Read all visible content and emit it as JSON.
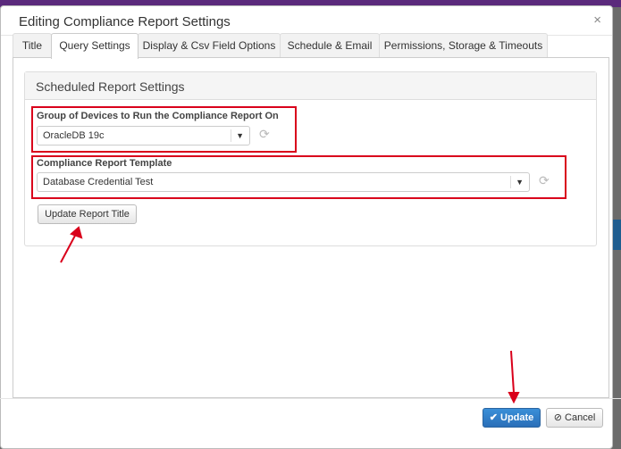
{
  "modal": {
    "title": "Editing Compliance Report Settings",
    "close_glyph": "×"
  },
  "tabs": [
    {
      "label": "Title",
      "active": false
    },
    {
      "label": "Query Settings",
      "active": true
    },
    {
      "label": "Display & Csv Field Options",
      "active": false
    },
    {
      "label": "Schedule & Email",
      "active": false
    },
    {
      "label": "Permissions, Storage & Timeouts",
      "active": false
    }
  ],
  "section": {
    "title": "Scheduled Report Settings"
  },
  "device_group": {
    "label": "Group of Devices to Run the Compliance Report On",
    "value": "OracleDB 19c"
  },
  "template": {
    "label": "Compliance Report Template",
    "value": "Database Credential Test"
  },
  "buttons": {
    "update_title": "Update Report Title",
    "update": "Update",
    "cancel": "Cancel"
  },
  "icons": {
    "refresh": "refresh-icon",
    "caret": "caret-down-icon",
    "check": "check-icon",
    "ban": "ban-icon"
  },
  "colors": {
    "highlight": "#d9001b",
    "primary": "#2a7ac6"
  }
}
